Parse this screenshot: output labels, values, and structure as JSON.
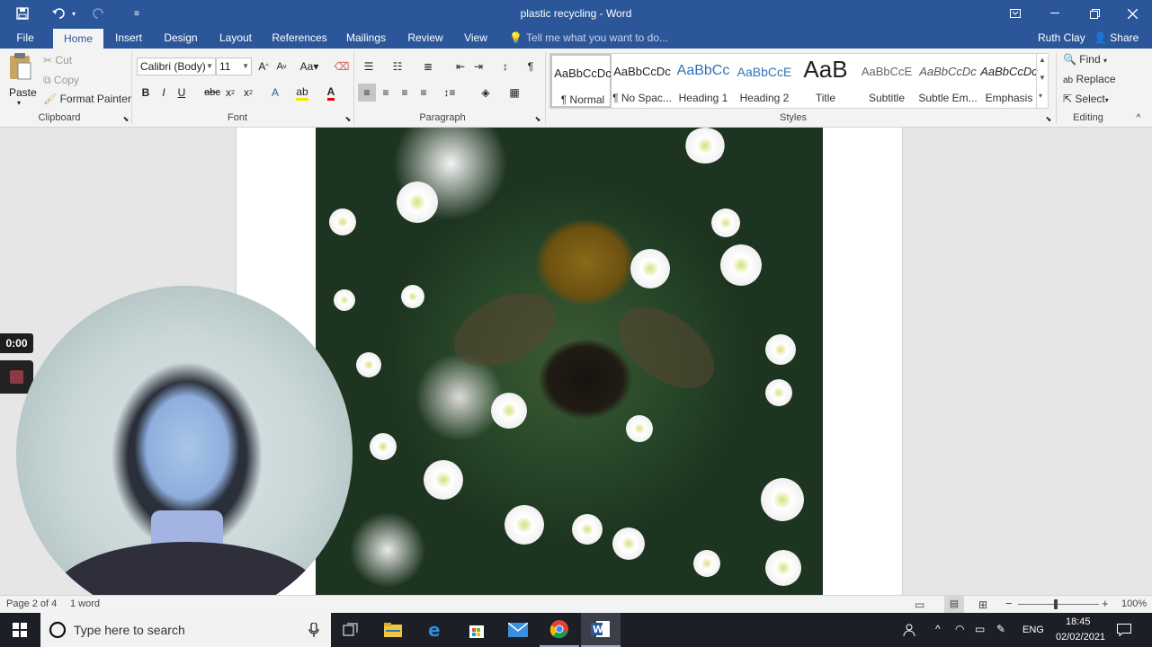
{
  "window": {
    "title": "plastic recycling - Word"
  },
  "tabs": [
    {
      "label": "File"
    },
    {
      "label": "Home"
    },
    {
      "label": "Insert"
    },
    {
      "label": "Design"
    },
    {
      "label": "Layout"
    },
    {
      "label": "References"
    },
    {
      "label": "Mailings"
    },
    {
      "label": "Review"
    },
    {
      "label": "View"
    }
  ],
  "tell_me": "Tell me what you want to do...",
  "user_name": "Ruth Clay",
  "share_label": "Share",
  "clipboard": {
    "paste": "Paste",
    "cut": "Cut",
    "copy": "Copy",
    "format_painter": "Format Painter",
    "group_label": "Clipboard"
  },
  "font": {
    "family": "Calibri (Body)",
    "size": "11",
    "group_label": "Font"
  },
  "paragraph": {
    "group_label": "Paragraph"
  },
  "styles": {
    "group_label": "Styles",
    "items": [
      {
        "preview": "AaBbCcDc",
        "name": "¶ Normal"
      },
      {
        "preview": "AaBbCcDc",
        "name": "¶ No Spac..."
      },
      {
        "preview": "AaBbCc",
        "name": "Heading 1"
      },
      {
        "preview": "AaBbCcE",
        "name": "Heading 2"
      },
      {
        "preview": "AaB",
        "name": "Title"
      },
      {
        "preview": "AaBbCcE",
        "name": "Subtitle"
      },
      {
        "preview": "AaBbCcDc",
        "name": "Subtle Em..."
      },
      {
        "preview": "AaBbCcDc",
        "name": "Emphasis"
      }
    ]
  },
  "editing": {
    "find": "Find",
    "replace": "Replace",
    "select": "Select",
    "group_label": "Editing"
  },
  "recorder": {
    "timer": "0:00"
  },
  "status": {
    "page": "Page 2 of 4",
    "words": "1 word",
    "zoom": "100%"
  },
  "taskbar": {
    "search_placeholder": "Type here to search",
    "language": "ENG",
    "time": "18:45",
    "date": "02/02/2021"
  }
}
